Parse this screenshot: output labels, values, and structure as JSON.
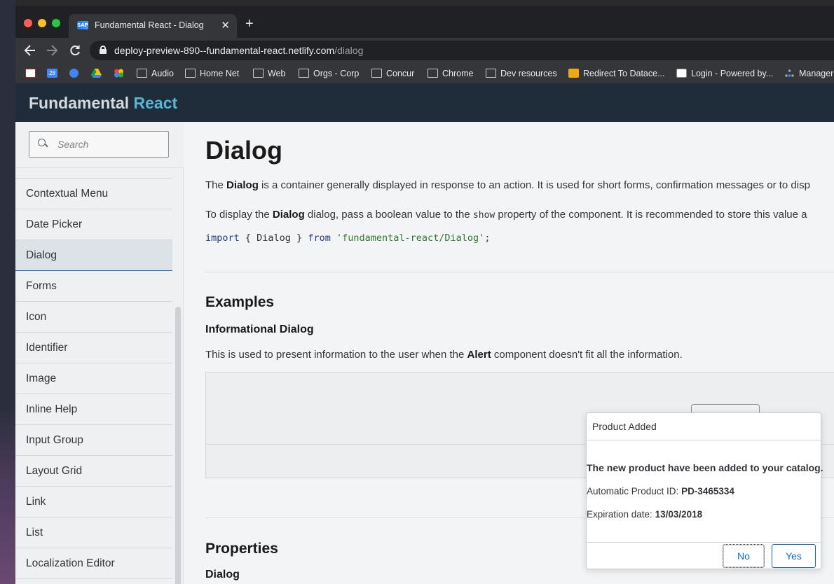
{
  "browser": {
    "tab_title": "Fundamental React - Dialog",
    "tab_favicon_text": "SAP",
    "new_tab_label": "+",
    "tab_close_label": "✕",
    "url_host": "deploy-preview-890--fundamental-react.netlify.com",
    "url_path": "/dialog",
    "bookmarks": [
      {
        "label": "",
        "icon": "gmail-icon"
      },
      {
        "label": "",
        "icon": "calendar-icon",
        "text": "28"
      },
      {
        "label": "",
        "icon": "contacts-icon"
      },
      {
        "label": "",
        "icon": "drive-icon"
      },
      {
        "label": "",
        "icon": "photos-icon"
      },
      {
        "label": "Audio",
        "icon": "folder-icon"
      },
      {
        "label": "Home Net",
        "icon": "folder-icon"
      },
      {
        "label": "Web",
        "icon": "folder-icon"
      },
      {
        "label": "Orgs - Corp",
        "icon": "folder-icon"
      },
      {
        "label": "Concur",
        "icon": "folder-icon"
      },
      {
        "label": "Chrome",
        "icon": "folder-icon"
      },
      {
        "label": "Dev resources",
        "icon": "folder-icon"
      },
      {
        "label": "Redirect To Datace...",
        "icon": "site-icon"
      },
      {
        "label": "Login - Powered by...",
        "icon": "site-icon"
      },
      {
        "label": "Manager",
        "icon": "site-icon"
      }
    ]
  },
  "header": {
    "brand_a": "Fundamental",
    "brand_b": "React",
    "brand_b_color": "#58b5d6"
  },
  "sidebar": {
    "search_placeholder": "Search",
    "items": [
      {
        "label": "Contextual Menu",
        "active": false
      },
      {
        "label": "Date Picker",
        "active": false
      },
      {
        "label": "Dialog",
        "active": true
      },
      {
        "label": "Forms",
        "active": false
      },
      {
        "label": "Icon",
        "active": false
      },
      {
        "label": "Identifier",
        "active": false
      },
      {
        "label": "Image",
        "active": false
      },
      {
        "label": "Inline Help",
        "active": false
      },
      {
        "label": "Input Group",
        "active": false
      },
      {
        "label": "Layout Grid",
        "active": false
      },
      {
        "label": "Link",
        "active": false
      },
      {
        "label": "List",
        "active": false
      },
      {
        "label": "Localization Editor",
        "active": false
      }
    ]
  },
  "main": {
    "title": "Dialog",
    "intro": {
      "pre": "The ",
      "bold": "Dialog",
      "post": " is a container generally displayed in response to an action. It is used for short forms, confirmation messages or to disp"
    },
    "usage": {
      "pre": "To display the ",
      "bold": "Dialog",
      "mid": " dialog, pass a boolean value to the ",
      "code": "show",
      "post": " property of the component. It is recommended to store this value a"
    },
    "import_code": {
      "kw1": "import",
      "mid": " { Dialog } ",
      "kw2": "from",
      "str": "'fundamental-react/Dialog'",
      "end": ";"
    },
    "examples_heading": "Examples",
    "example_title": "Informational Dialog",
    "example_desc": {
      "pre": "This is used to present information to the user when the ",
      "bold": "Alert",
      "post": " component doesn't fit all the information."
    },
    "properties_heading": "Properties",
    "properties_sub": "Dialog"
  },
  "dialog": {
    "title": "Product Added",
    "message": "The new product have been added to your catalog.",
    "product_id_label": "Automatic Product ID: ",
    "product_id_value": "PD-3465334",
    "expiration_label": "Expiration date: ",
    "expiration_value": "13/03/2018",
    "no_label": "No",
    "yes_label": "Yes",
    "accent_color": "#0a6ed1"
  }
}
